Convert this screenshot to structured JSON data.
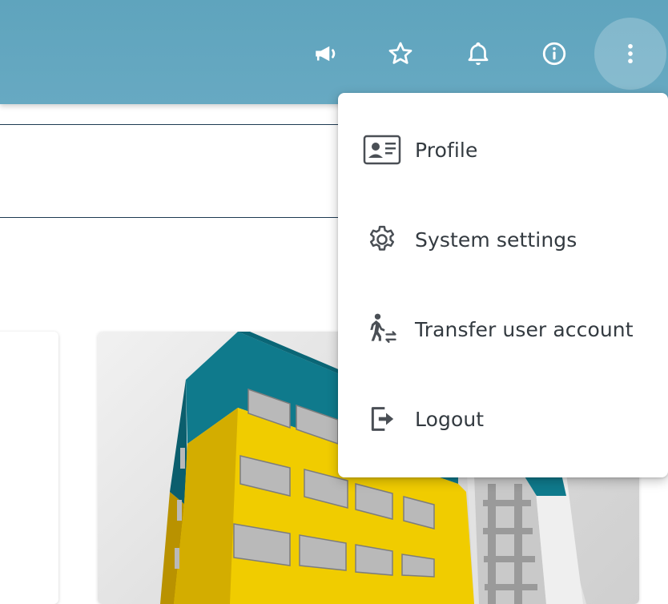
{
  "colors": {
    "topbar": "#5fa4bd",
    "icon_white": "#ffffff",
    "menu_text": "#333a40",
    "menu_icon": "#4a4f55",
    "building_teal": "#0f7a8c",
    "building_yellow": "#f0cc00",
    "window_gray": "#b9b9b9"
  },
  "topbar": {
    "buttons": [
      {
        "name": "announcement-button",
        "icon": "megaphone-icon"
      },
      {
        "name": "favorites-button",
        "icon": "star-icon"
      },
      {
        "name": "notifications-button",
        "icon": "bell-icon"
      },
      {
        "name": "info-button",
        "icon": "info-icon"
      },
      {
        "name": "more-options-button",
        "icon": "more-vertical-icon",
        "active": true
      }
    ]
  },
  "user_menu": {
    "items": [
      {
        "label": "Profile",
        "icon": "id-card-icon"
      },
      {
        "label": "System settings",
        "icon": "gear-icon"
      },
      {
        "label": "Transfer user account",
        "icon": "transfer-user-icon"
      },
      {
        "label": "Logout",
        "icon": "logout-icon"
      }
    ]
  }
}
